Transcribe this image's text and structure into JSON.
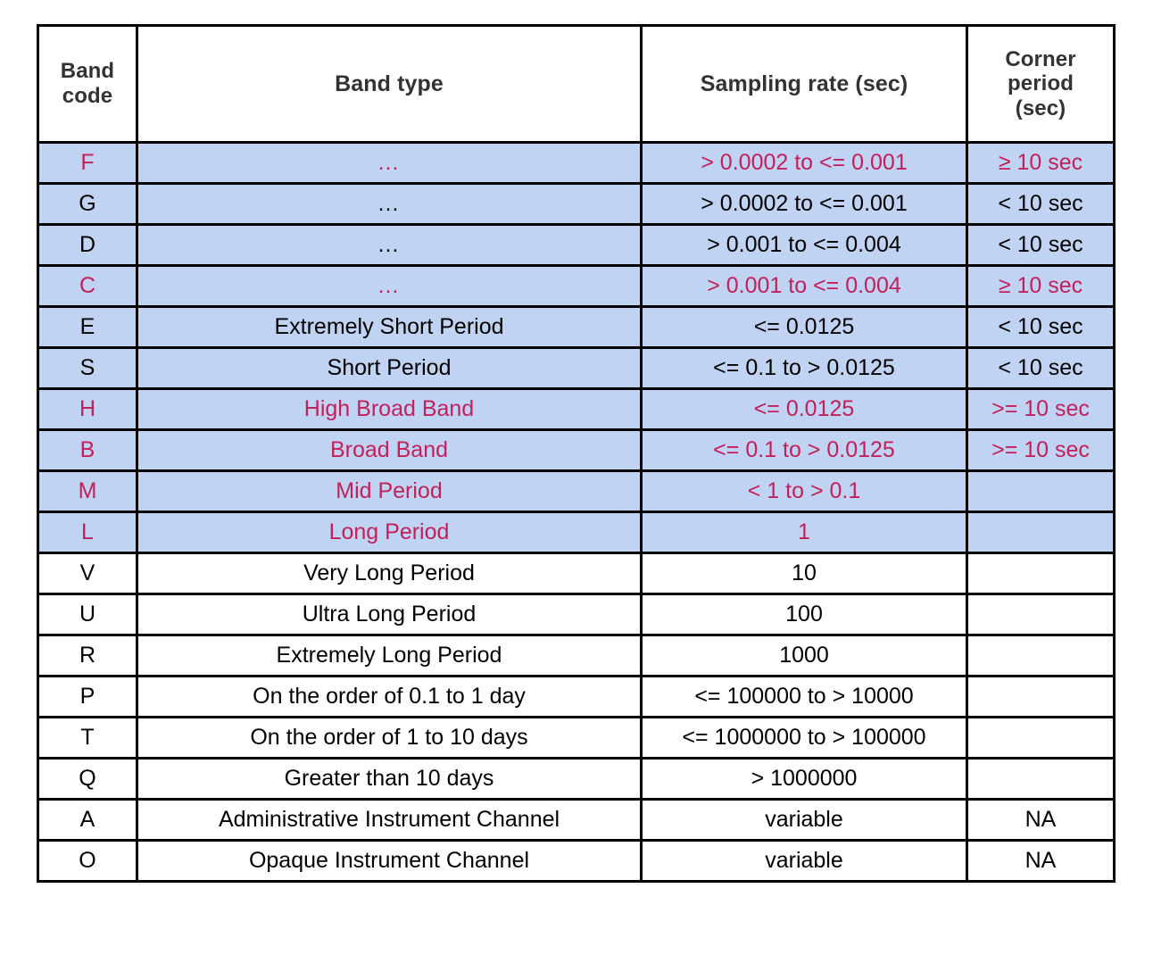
{
  "table": {
    "columns": [
      {
        "key": "code",
        "label": "Band\ncode",
        "label_line1": "Band",
        "label_line2": "code"
      },
      {
        "key": "type",
        "label": "Band type"
      },
      {
        "key": "rate",
        "label": "Sampling rate (sec)"
      },
      {
        "key": "corner",
        "label": "Corner\nperiod\n(sec)",
        "label_line1": "Corner",
        "label_line2": "period",
        "label_line3": "(sec)"
      }
    ],
    "headers": {
      "band_code_line1": "Band",
      "band_code_line2": "code",
      "band_type": "Band type",
      "sampling_rate": "Sampling rate (sec)",
      "corner_period_line1": "Corner",
      "corner_period_line2": "period",
      "corner_period_line3": "(sec)"
    },
    "rows": [
      {
        "code": "F",
        "type": "…",
        "rate": "> 0.0002 to <= 0.001",
        "corner": "≥ 10 sec",
        "highlight": true,
        "pink": true
      },
      {
        "code": "G",
        "type": "…",
        "rate": "> 0.0002 to <= 0.001",
        "corner": "< 10 sec",
        "highlight": true,
        "pink": false
      },
      {
        "code": "D",
        "type": "…",
        "rate": "> 0.001 to <= 0.004",
        "corner": "< 10 sec",
        "highlight": true,
        "pink": false
      },
      {
        "code": "C",
        "type": "…",
        "rate": "> 0.001 to <= 0.004",
        "corner": "≥ 10 sec",
        "highlight": true,
        "pink": true
      },
      {
        "code": "E",
        "type": "Extremely Short Period",
        "rate": "<= 0.0125",
        "corner": "< 10 sec",
        "highlight": true,
        "pink": false
      },
      {
        "code": "S",
        "type": "Short Period",
        "rate": "<= 0.1 to > 0.0125",
        "corner": "< 10 sec",
        "highlight": true,
        "pink": false
      },
      {
        "code": "H",
        "type": "High Broad Band",
        "rate": "<= 0.0125",
        "corner": ">= 10 sec",
        "highlight": true,
        "pink": true
      },
      {
        "code": "B",
        "type": "Broad Band",
        "rate": "<= 0.1 to > 0.0125",
        "corner": ">= 10 sec",
        "highlight": true,
        "pink": true
      },
      {
        "code": "M",
        "type": "Mid Period",
        "rate": "< 1 to > 0.1",
        "corner": "",
        "highlight": true,
        "pink": true
      },
      {
        "code": "L",
        "type": "Long Period",
        "rate": "1",
        "corner": "",
        "highlight": true,
        "pink": true
      },
      {
        "code": "V",
        "type": "Very Long Period",
        "rate": "10",
        "corner": "",
        "highlight": false,
        "pink": false
      },
      {
        "code": "U",
        "type": "Ultra Long Period",
        "rate": "100",
        "corner": "",
        "highlight": false,
        "pink": false
      },
      {
        "code": "R",
        "type": "Extremely Long Period",
        "rate": "1000",
        "corner": "",
        "highlight": false,
        "pink": false
      },
      {
        "code": "P",
        "type": "On the order of 0.1 to 1 day",
        "rate": "<= 100000 to > 10000",
        "corner": "",
        "highlight": false,
        "pink": false
      },
      {
        "code": "T",
        "type": "On the order of 1 to 10 days",
        "rate": "<= 1000000 to > 100000",
        "corner": "",
        "highlight": false,
        "pink": false
      },
      {
        "code": "Q",
        "type": "Greater than 10 days",
        "rate": "> 1000000",
        "corner": "",
        "highlight": false,
        "pink": false
      },
      {
        "code": "A",
        "type": "Administrative Instrument Channel",
        "rate": "variable",
        "corner": "NA",
        "highlight": false,
        "pink": false
      },
      {
        "code": "O",
        "type": "Opaque Instrument Channel",
        "rate": "variable",
        "corner": "NA",
        "highlight": false,
        "pink": false
      }
    ]
  },
  "colors": {
    "highlight_row_background": "#c1d3f2",
    "emphasis_text": "#c2205a",
    "header_text": "#333333",
    "body_text": "#000000",
    "border": "#000000",
    "page_background": "#ffffff"
  }
}
